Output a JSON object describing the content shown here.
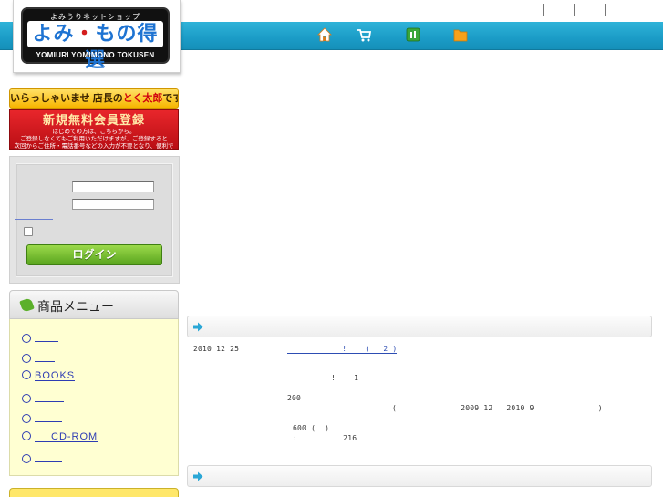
{
  "header": {
    "utility_links": [
      "",
      "",
      ""
    ],
    "nav_icons": [
      "home-icon",
      "cart-icon",
      "book-icon",
      "folder-icon"
    ],
    "colors": {
      "teal": "#1b9cc7",
      "yellow_menu": "#ffffd2",
      "link": "#2d3cb3"
    }
  },
  "logo": {
    "subtitle": "よみうりネットショップ",
    "main_part1": "よみ",
    "main_dot": "・",
    "main_part2": "もの得選",
    "english": "YOMIURI YOMIMONO TOKUSEN"
  },
  "sidebar": {
    "welcome_prefix": "いらっしゃいませ 店長の",
    "welcome_name": "とく太郎",
    "welcome_suffix": "です。",
    "register_title": "新規無料会員登録",
    "register_line1": "はじめての方は、こちらから。",
    "register_line2": "ご登録しなくてもご利用いただけますが、ご登録すると",
    "register_line3": "次回からご住所・電話番号などの入力が不要となり、便利です。",
    "login_button": "ログイン",
    "menu_title": "商品メニュー",
    "menu_items": [
      "",
      "",
      "BOOKS",
      "",
      "",
      "CD-ROM",
      ""
    ]
  },
  "main": {
    "news": {
      "date": "2010 12 25",
      "link_text": "            !    (   2 )",
      "line1": "!    1",
      "line2": "200",
      "line3": "(         !    2009 12   2010 9              )",
      "line4": "600 (  )",
      "line5": ":          216"
    }
  }
}
